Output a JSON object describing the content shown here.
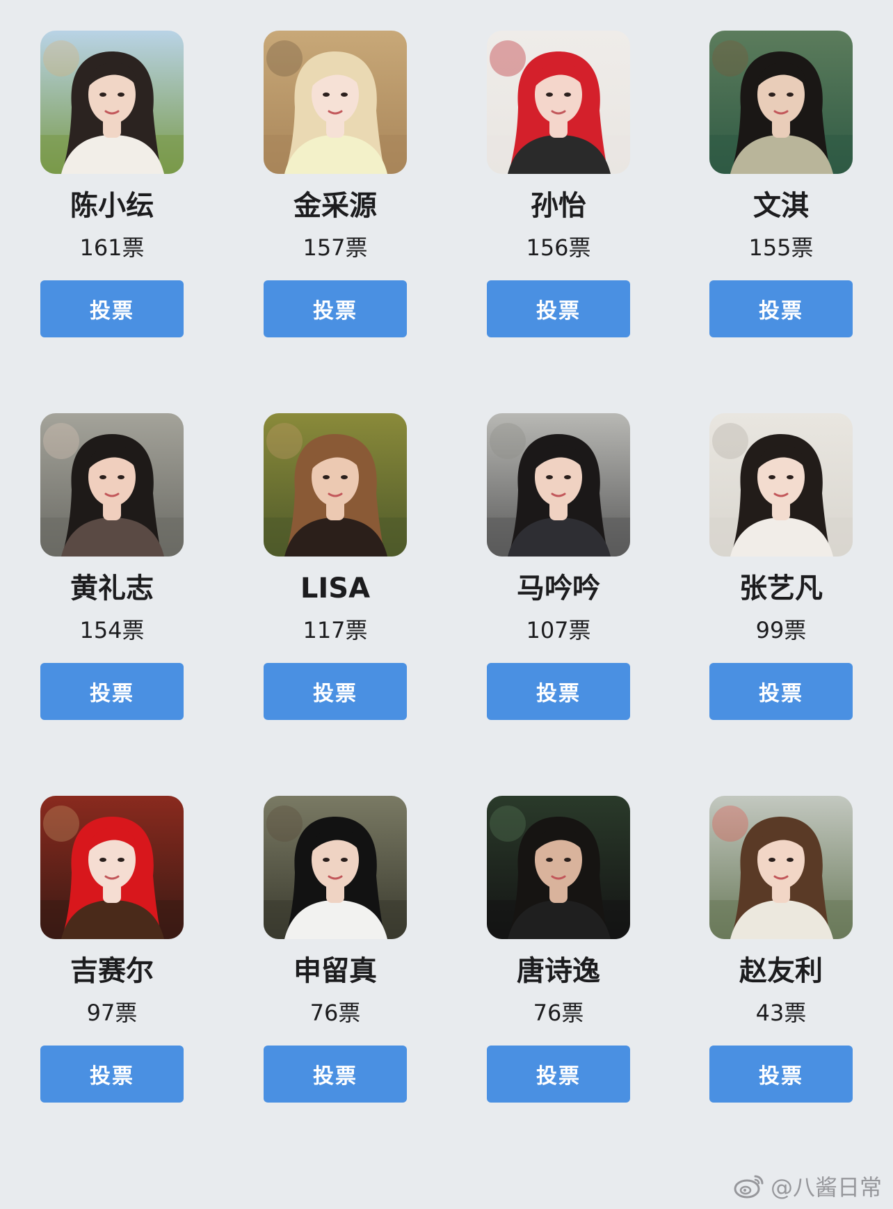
{
  "candidates": [
    {
      "name": "陈小纭",
      "votes": "161票",
      "photo": {
        "bg": "#7a9a4a",
        "sky": "#b9d3e6",
        "hair": "#2b2320",
        "skin": "#f1d6c6",
        "outfit": "#f2eee8",
        "accent": "#d8b37a"
      }
    },
    {
      "name": "金采源",
      "votes": "157票",
      "photo": {
        "bg": "#a9865a",
        "sky": "#c8a878",
        "hair": "#ead9b3",
        "skin": "#f6e1d6",
        "outfit": "#f3f1c9",
        "accent": "#6f5a3f"
      }
    },
    {
      "name": "孙怡",
      "votes": "156票",
      "photo": {
        "bg": "#e9e6e2",
        "sky": "#efece9",
        "hair": "#d4202b",
        "skin": "#f4d6cb",
        "outfit": "#2a2a2a",
        "accent": "#b61a22"
      }
    },
    {
      "name": "文淇",
      "votes": "155票",
      "photo": {
        "bg": "#2f5a44",
        "sky": "#5c7c5c",
        "hair": "#1a1715",
        "skin": "#e9cdb9",
        "outfit": "#b9b59a",
        "accent": "#7a5a3a"
      }
    },
    {
      "name": "黄礼志",
      "votes": "154票",
      "photo": {
        "bg": "#6a6a64",
        "sky": "#a4a39a",
        "hair": "#1e1a18",
        "skin": "#f0cfbe",
        "outfit": "#5a4a44",
        "accent": "#d9c7b6"
      }
    },
    {
      "name": "LISA",
      "votes": "117票",
      "photo": {
        "bg": "#4f5a2a",
        "sky": "#8a8a3a",
        "hair": "#8a5a36",
        "skin": "#ecc9b2",
        "outfit": "#2b1f1a",
        "accent": "#c49a6a"
      }
    },
    {
      "name": "马吟吟",
      "votes": "107票",
      "photo": {
        "bg": "#5a5a5a",
        "sky": "#b8b8b4",
        "hair": "#1b1818",
        "skin": "#f0d2c2",
        "outfit": "#2e2e33",
        "accent": "#8b8b88"
      }
    },
    {
      "name": "张艺凡",
      "votes": "99票",
      "photo": {
        "bg": "#d9d6cf",
        "sky": "#e9e6e0",
        "hair": "#221c19",
        "skin": "#f3dccf",
        "outfit": "#f1ede8",
        "accent": "#b3ada3"
      }
    },
    {
      "name": "吉赛尔",
      "votes": "97票",
      "photo": {
        "bg": "#3a1a14",
        "sky": "#8a2a1e",
        "hair": "#d8171c",
        "skin": "#f5ddd2",
        "outfit": "#4a2a1a",
        "accent": "#c79a6a"
      }
    },
    {
      "name": "申留真",
      "votes": "76票",
      "photo": {
        "bg": "#3a3a2e",
        "sky": "#7a7a64",
        "hair": "#121212",
        "skin": "#efd3c3",
        "outfit": "#f2f2f0",
        "accent": "#5a4a3a"
      }
    },
    {
      "name": "唐诗逸",
      "votes": "76票",
      "photo": {
        "bg": "#141414",
        "sky": "#2a3a2a",
        "hair": "#161412",
        "skin": "#d9b39c",
        "outfit": "#1f1f1f",
        "accent": "#5a7a5a"
      }
    },
    {
      "name": "赵友利",
      "votes": "43票",
      "photo": {
        "bg": "#6a7a5a",
        "sky": "#c3c8c0",
        "hair": "#5a3a26",
        "skin": "#f2d6c6",
        "outfit": "#ece8de",
        "accent": "#e0544a"
      }
    }
  ],
  "vote_button_label": "投票",
  "watermark": {
    "icon": "weibo-logo-icon",
    "text": "@八酱日常"
  },
  "colors": {
    "background": "#e8ebee",
    "button": "#4a90e2",
    "button_text": "#ffffff",
    "text": "#1c1c1e",
    "watermark": "#8e8e93"
  }
}
